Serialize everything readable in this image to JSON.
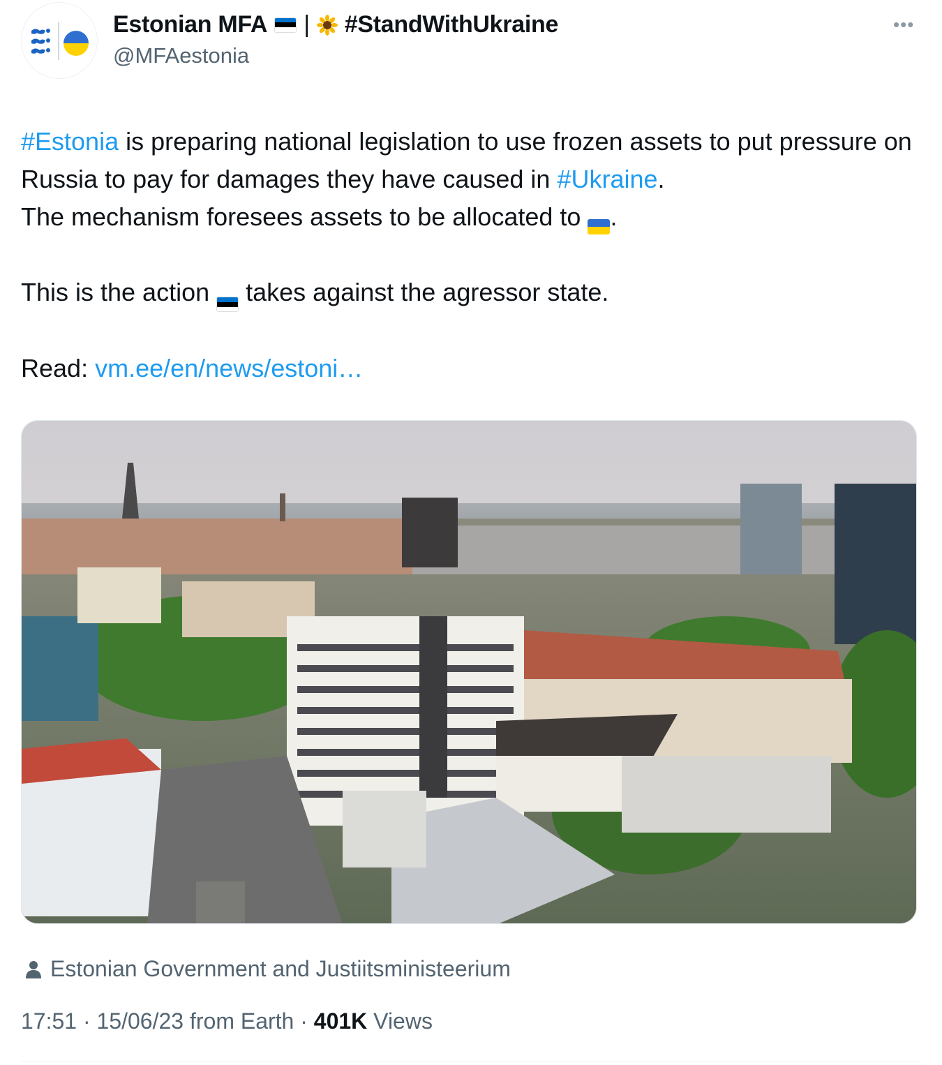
{
  "author": {
    "display_name": "Estonian MFA",
    "separator": "|",
    "hashtag_name": "#StandWithUkraine",
    "handle": "@MFAestonia",
    "avatar_icon": "estonia-mfa-logo-icon",
    "more_icon": "more-options-icon"
  },
  "tweet": {
    "p1_hashtag1": "#Estonia",
    "p1_text1": " is preparing national legislation to use frozen assets to put pressure on Russia to pay for damages they have caused in ",
    "p1_hashtag2": "#Ukraine",
    "p1_text2": ".",
    "p1_line2": "The mechanism foresees assets to be allocated to ",
    "p1_line2_end": ".",
    "p2_text1": "This is the action ",
    "p2_text2": " takes against the agressor state.",
    "p3_label": "Read: ",
    "p3_link": "vm.ee/en/news/estoni…"
  },
  "media": {
    "tagged_icon": "person-icon",
    "tagged": "Estonian Government and Justiitsministeerium"
  },
  "meta": {
    "time": "17:51",
    "dot1": " · ",
    "date": "15/06/23",
    "source": " from Earth",
    "dot2": " · ",
    "views_count": "401K",
    "views_label": " Views"
  },
  "colors": {
    "link": "#1d9bf0",
    "secondary_text": "#536471",
    "ukraine_blue": "#2f6fd0",
    "ukraine_yellow": "#ffd200",
    "estonia_blue": "#0072ce"
  }
}
